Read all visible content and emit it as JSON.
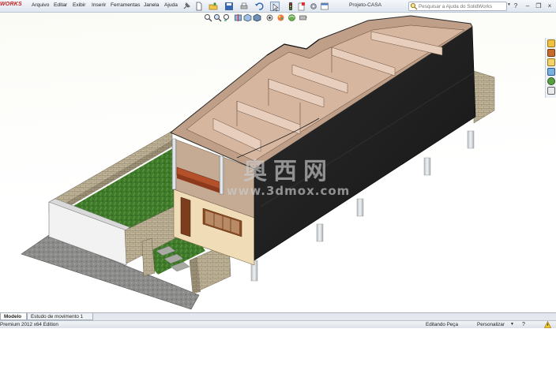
{
  "app": {
    "logo_text": "WORKS",
    "document_title": "Projeto-CASA"
  },
  "menu": {
    "items": [
      {
        "label": "Arquivo"
      },
      {
        "label": "Editar"
      },
      {
        "label": "Exibir"
      },
      {
        "label": "Inserir"
      },
      {
        "label": "Ferramentas"
      },
      {
        "label": "Janela"
      },
      {
        "label": "Ajuda"
      }
    ]
  },
  "toolbar": {
    "icons": [
      "pin-icon",
      "new-document-icon",
      "open-icon",
      "save-icon",
      "print-icon",
      "undo-icon",
      "select-icon",
      "rebuild-icon",
      "file-properties-icon",
      "options-icon",
      "layout-icon"
    ]
  },
  "help_search": {
    "placeholder": "Pesquisar a Ajuda do SolidWorks"
  },
  "window_controls": {
    "help_label": "?",
    "minimize": "–",
    "restore": "❐",
    "close": "×"
  },
  "heads_up_toolbar": {
    "icons": [
      "zoom-fit-icon",
      "zoom-area-icon",
      "previous-view-icon",
      "section-view-icon",
      "view-orientation-icon",
      "display-style-icon",
      "hide-show-icon",
      "edit-appearance-icon",
      "apply-scene-icon",
      "view-settings-icon"
    ]
  },
  "task_pane": {
    "icons": [
      "solidworks-resources-icon",
      "design-library-icon",
      "file-explorer-icon",
      "view-palette-icon",
      "appearances-icon",
      "custom-properties-icon"
    ]
  },
  "watermark": {
    "chinese": "奧西网",
    "url": "www.3dmox.com"
  },
  "tabs": [
    {
      "label": "Modelo",
      "active": true
    },
    {
      "label": "Estudo de movimento 1",
      "active": false
    }
  ],
  "status": {
    "edition": "Premium 2012 x64 Edition",
    "mode": "Editando Peça",
    "customize": "Personalizar",
    "help": "?"
  },
  "colors": {
    "roof": "#1f1f1f",
    "brick": "#b9ac92",
    "lawn": "#3f7a2c",
    "paving": "#8a8a88",
    "wall_plaster": "#efdcb8",
    "interior": "#c9a58e",
    "columns": "#d4d9dc"
  }
}
